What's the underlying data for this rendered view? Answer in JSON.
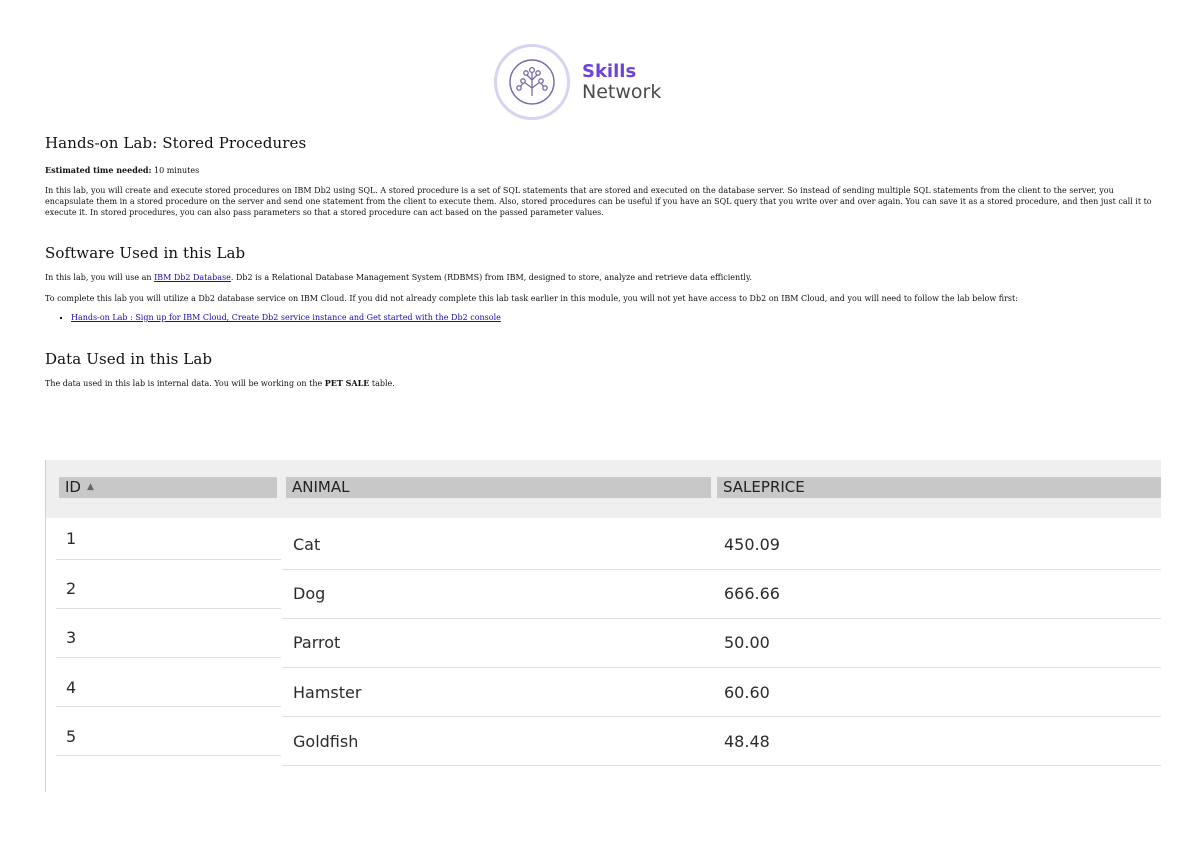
{
  "logo": {
    "line1": "Skills",
    "line2": "Network",
    "icon": "tree-network-icon",
    "brand_color": "#6c44d9"
  },
  "title": "Hands-on Lab: Stored Procedures",
  "estimated": {
    "label": "Estimated time needed:",
    "value": "10 minutes"
  },
  "intro": "In this lab, you will create and execute stored procedures on IBM Db2 using SQL. A stored procedure is a set of SQL statements that are stored and executed on the database server. So instead of sending multiple SQL statements from the client to the server, you encapsulate them in a stored procedure on the server and send one statement from the client to execute them. Also, stored procedures can be useful if you have an SQL query that you write over and over again. You can save it as a stored procedure, and then just call it to execute it. In stored procedures, you can also pass parameters so that a stored procedure can act based on the passed parameter values.",
  "software": {
    "heading": "Software Used in this Lab",
    "p1_before": "In this lab, you will use an ",
    "p1_link": "IBM Db2 Database",
    "p1_after": ". Db2 is a Relational Database Management System (RDBMS) from IBM, designed to store, analyze and retrieve data efficiently.",
    "p2": "To complete this lab you will utilize a Db2 database service on IBM Cloud. If you did not already complete this lab task earlier in this module, you will not yet have access to Db2 on IBM Cloud, and you will need to follow the lab below first:",
    "link_item": "Hands-on Lab : Sign up for IBM Cloud, Create Db2 service instance and Get started with the Db2 console"
  },
  "data_section": {
    "heading": "Data Used in this Lab",
    "desc_before": "The data used in this lab is internal data. You will be working on the ",
    "desc_bold": "PET SALE",
    "desc_after": " table."
  },
  "table": {
    "columns": [
      "ID",
      "ANIMAL",
      "SALEPRICE"
    ],
    "rows": [
      [
        "1",
        "Cat",
        "450.09"
      ],
      [
        "2",
        "Dog",
        "666.66"
      ],
      [
        "3",
        "Parrot",
        "50.00"
      ],
      [
        "4",
        "Hamster",
        "60.60"
      ],
      [
        "5",
        "Goldfish",
        "48.48"
      ]
    ]
  }
}
